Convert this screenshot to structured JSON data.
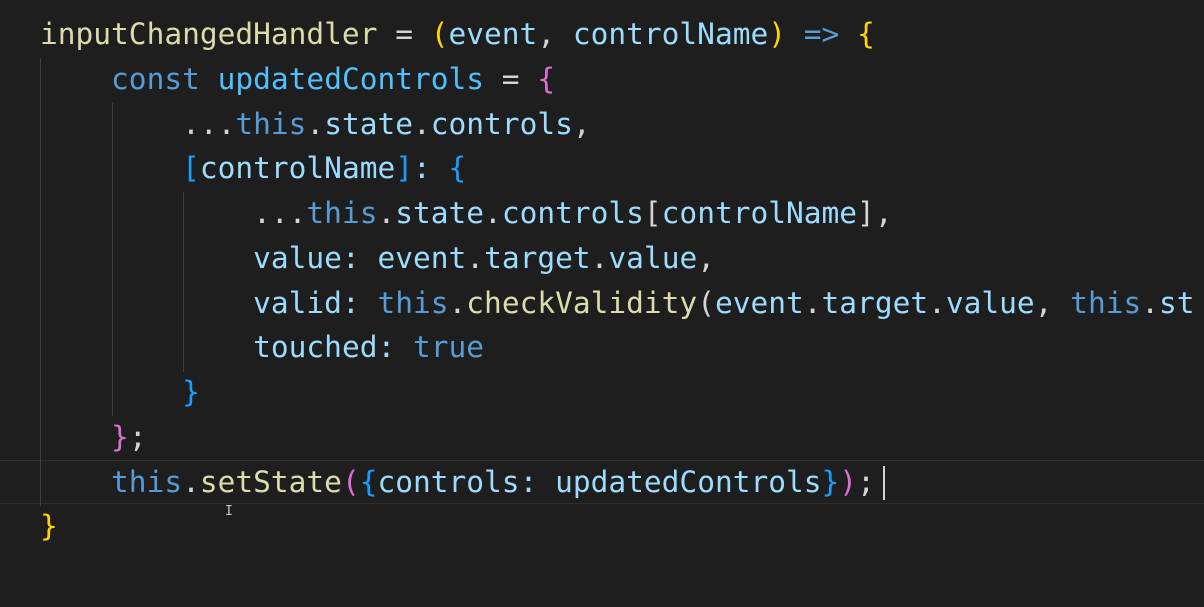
{
  "editor": {
    "language": "javascript",
    "theme_background": "#1e1e1e",
    "colors": {
      "keyword": "#569cd6",
      "function": "#dcdcaa",
      "variable": "#9cdcfe",
      "constant": "#4fc1ff",
      "punctuation": "#d4d4d4"
    },
    "lines": [
      {
        "tokens": [
          {
            "t": "inputChangedHandler",
            "c": "fn"
          },
          {
            "t": " = ",
            "c": "op"
          },
          {
            "t": "(",
            "c": "gold"
          },
          {
            "t": "event",
            "c": "var"
          },
          {
            "t": ", ",
            "c": "op"
          },
          {
            "t": "controlName",
            "c": "var"
          },
          {
            "t": ")",
            "c": "gold"
          },
          {
            "t": " ",
            "c": "op"
          },
          {
            "t": "=>",
            "c": "kw"
          },
          {
            "t": " ",
            "c": "op"
          },
          {
            "t": "{",
            "c": "gold"
          }
        ]
      },
      {
        "tokens": [
          {
            "t": "    ",
            "c": "op"
          },
          {
            "t": "const",
            "c": "kw"
          },
          {
            "t": " ",
            "c": "op"
          },
          {
            "t": "updatedControls",
            "c": "const"
          },
          {
            "t": " = ",
            "c": "op"
          },
          {
            "t": "{",
            "c": "purple"
          }
        ]
      },
      {
        "tokens": [
          {
            "t": "        ...",
            "c": "op"
          },
          {
            "t": "this",
            "c": "kw"
          },
          {
            "t": ".",
            "c": "op"
          },
          {
            "t": "state",
            "c": "var"
          },
          {
            "t": ".",
            "c": "op"
          },
          {
            "t": "controls",
            "c": "var"
          },
          {
            "t": ",",
            "c": "op"
          }
        ]
      },
      {
        "tokens": [
          {
            "t": "        ",
            "c": "op"
          },
          {
            "t": "[",
            "c": "blue"
          },
          {
            "t": "controlName",
            "c": "var"
          },
          {
            "t": "]",
            "c": "blue"
          },
          {
            "t": ": ",
            "c": "var"
          },
          {
            "t": "{",
            "c": "blue"
          }
        ]
      },
      {
        "tokens": [
          {
            "t": "            ...",
            "c": "op"
          },
          {
            "t": "this",
            "c": "kw"
          },
          {
            "t": ".",
            "c": "op"
          },
          {
            "t": "state",
            "c": "var"
          },
          {
            "t": ".",
            "c": "op"
          },
          {
            "t": "controls",
            "c": "var"
          },
          {
            "t": "[",
            "c": "op"
          },
          {
            "t": "controlName",
            "c": "var"
          },
          {
            "t": "]",
            "c": "op"
          },
          {
            "t": ",",
            "c": "op"
          }
        ]
      },
      {
        "tokens": [
          {
            "t": "            ",
            "c": "op"
          },
          {
            "t": "value",
            "c": "var"
          },
          {
            "t": ": ",
            "c": "var"
          },
          {
            "t": "event",
            "c": "var"
          },
          {
            "t": ".",
            "c": "op"
          },
          {
            "t": "target",
            "c": "var"
          },
          {
            "t": ".",
            "c": "op"
          },
          {
            "t": "value",
            "c": "var"
          },
          {
            "t": ",",
            "c": "op"
          }
        ]
      },
      {
        "tokens": [
          {
            "t": "            ",
            "c": "op"
          },
          {
            "t": "valid",
            "c": "var"
          },
          {
            "t": ": ",
            "c": "var"
          },
          {
            "t": "this",
            "c": "kw"
          },
          {
            "t": ".",
            "c": "op"
          },
          {
            "t": "checkValidity",
            "c": "fn"
          },
          {
            "t": "(",
            "c": "op"
          },
          {
            "t": "event",
            "c": "var"
          },
          {
            "t": ".",
            "c": "op"
          },
          {
            "t": "target",
            "c": "var"
          },
          {
            "t": ".",
            "c": "op"
          },
          {
            "t": "value",
            "c": "var"
          },
          {
            "t": ", ",
            "c": "op"
          },
          {
            "t": "this",
            "c": "kw"
          },
          {
            "t": ".",
            "c": "op"
          },
          {
            "t": "st",
            "c": "var"
          }
        ]
      },
      {
        "tokens": [
          {
            "t": "            ",
            "c": "op"
          },
          {
            "t": "touched",
            "c": "var"
          },
          {
            "t": ": ",
            "c": "var"
          },
          {
            "t": "true",
            "c": "kw"
          }
        ]
      },
      {
        "tokens": [
          {
            "t": "        ",
            "c": "op"
          },
          {
            "t": "}",
            "c": "blue"
          }
        ]
      },
      {
        "tokens": [
          {
            "t": "    ",
            "c": "op"
          },
          {
            "t": "}",
            "c": "purple"
          },
          {
            "t": ";",
            "c": "op"
          }
        ]
      },
      {
        "tokens": [
          {
            "t": "    ",
            "c": "op"
          },
          {
            "t": "this",
            "c": "kw"
          },
          {
            "t": ".",
            "c": "op"
          },
          {
            "t": "setState",
            "c": "fn"
          },
          {
            "t": "(",
            "c": "purple"
          },
          {
            "t": "{",
            "c": "blue"
          },
          {
            "t": "controls",
            "c": "var"
          },
          {
            "t": ": ",
            "c": "var"
          },
          {
            "t": "updatedControls",
            "c": "var"
          },
          {
            "t": "}",
            "c": "blue"
          },
          {
            "t": ")",
            "c": "purple"
          },
          {
            "t": ";",
            "c": "op"
          }
        ]
      },
      {
        "tokens": [
          {
            "t": "}",
            "c": "gold"
          }
        ]
      },
      {
        "tokens": [
          {
            "t": "",
            "c": "op"
          }
        ]
      }
    ]
  }
}
